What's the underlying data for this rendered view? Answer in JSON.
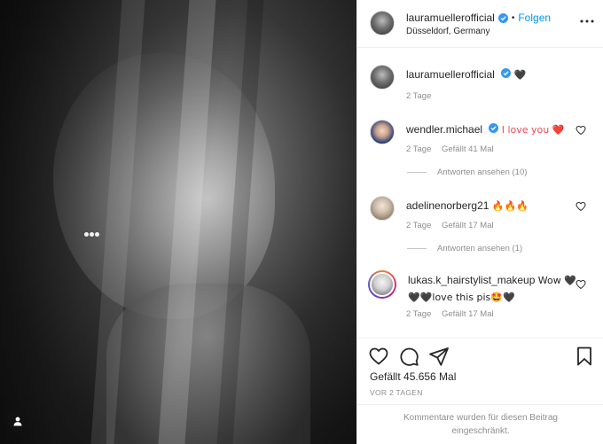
{
  "media": {
    "user_tag_icon": "person-icon"
  },
  "header": {
    "username": "lauramuellerofficial",
    "separator": "•",
    "follow_label": "Folgen",
    "location": "Düsseldorf, Germany",
    "more_icon": "more-horizontal-icon",
    "more_label": "• • •"
  },
  "caption": {
    "username": "lauramuellerofficial",
    "text": "🖤",
    "time": "2 Tage"
  },
  "comments": [
    {
      "username": "wendler.michael",
      "verified": true,
      "text": "I love you ❤️",
      "time": "2 Tage",
      "likes": "Gefällt 41 Mal",
      "replies": "Antworten ansehen (10)"
    },
    {
      "username": "adelinenorberg21",
      "verified": false,
      "text": "🔥🔥🔥",
      "time": "2 Tage",
      "likes": "Gefällt 17 Mal",
      "replies": "Antworten ansehen (1)"
    },
    {
      "username": "lukas.k_hairstylist_makeup",
      "verified": false,
      "text": "Wow 🖤🖤🖤love this pis🤩🖤",
      "time": "2 Tage",
      "likes": "Gefällt 17 Mal"
    }
  ],
  "actions": {
    "like_icon": "heart-icon",
    "comment_icon": "comment-icon",
    "share_icon": "share-icon",
    "save_icon": "bookmark-icon"
  },
  "likes": "Gefällt 45.656 Mal",
  "date": "VOR 2 TAGEN",
  "restricted_notice": "Kommentare wurden für diesen Beitrag eingeschränkt.",
  "colors": {
    "link_blue": "#0095f6",
    "text": "#262626",
    "secondary_text": "#8e8e8e",
    "border": "#efefef"
  }
}
